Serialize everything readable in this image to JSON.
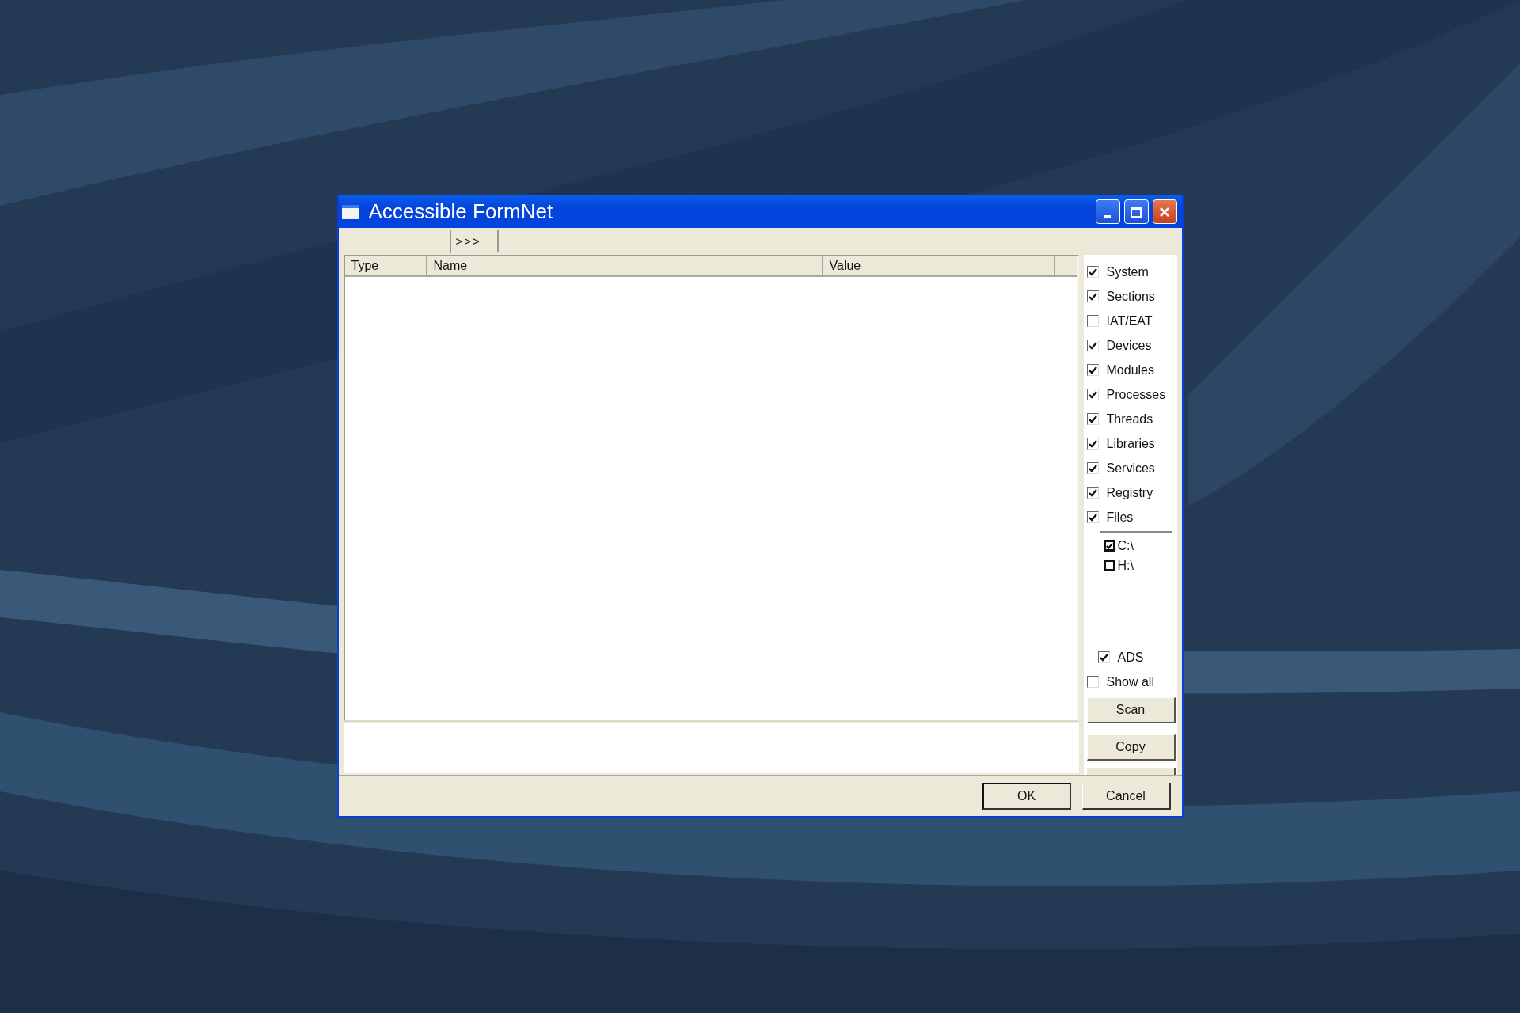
{
  "window": {
    "title": "Accessible FormNet"
  },
  "tabs": [
    {
      "label": ">>>",
      "selected": false
    }
  ],
  "table": {
    "columns": [
      "Type",
      "Name",
      "Value"
    ]
  },
  "options": [
    {
      "label": "System",
      "checked": true
    },
    {
      "label": "Sections",
      "checked": true
    },
    {
      "label": "IAT/EAT",
      "checked": false
    },
    {
      "label": "Devices",
      "checked": true
    },
    {
      "label": "Modules",
      "checked": true
    },
    {
      "label": "Processes",
      "checked": true
    },
    {
      "label": "Threads",
      "checked": true
    },
    {
      "label": "Libraries",
      "checked": true
    },
    {
      "label": "Services",
      "checked": true
    },
    {
      "label": "Registry",
      "checked": true
    },
    {
      "label": "Files",
      "checked": true
    }
  ],
  "drives": [
    {
      "label": "C:\\",
      "checked": true
    },
    {
      "label": "H:\\",
      "checked": false
    }
  ],
  "file_options": [
    {
      "label": "ADS",
      "checked": true
    },
    {
      "label": "Show all",
      "checked": false
    }
  ],
  "side_buttons": [
    "Scan",
    "Copy"
  ],
  "dialog_buttons": [
    {
      "label": "OK",
      "default": true
    },
    {
      "label": "Cancel",
      "default": false
    }
  ]
}
